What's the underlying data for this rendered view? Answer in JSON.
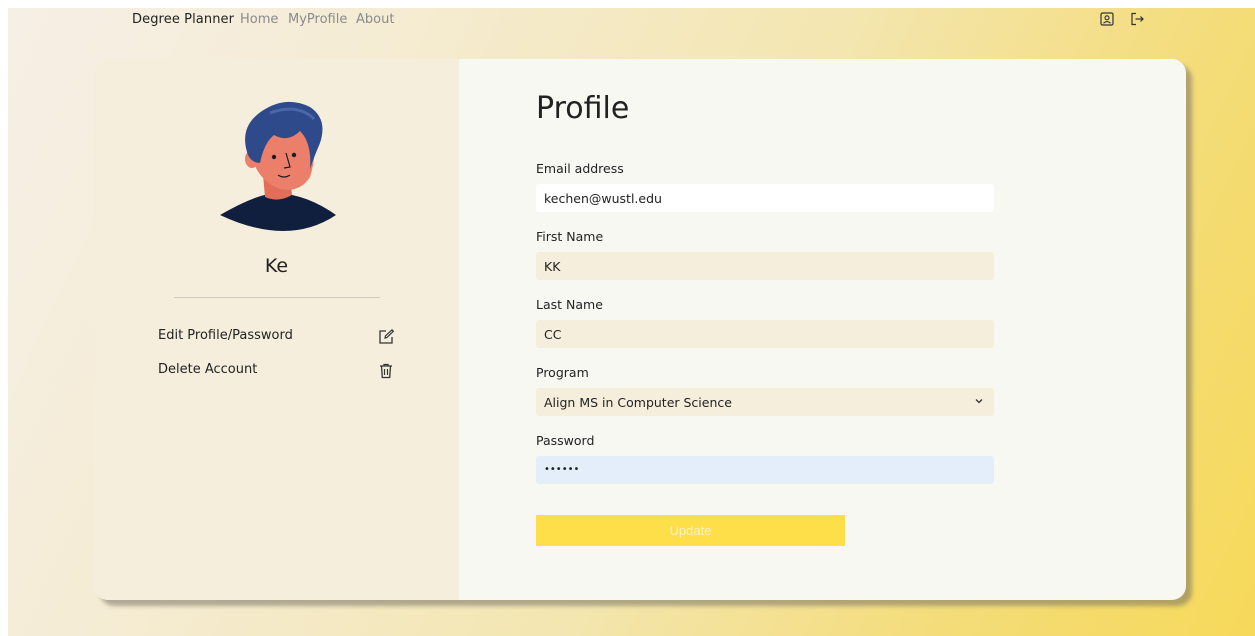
{
  "navbar": {
    "brand": "Degree Planner",
    "links": [
      "Home",
      "MyProfile",
      "About"
    ],
    "icons": [
      "profile-icon",
      "logout-icon"
    ]
  },
  "sidebar": {
    "user_name": "Ke",
    "menu": [
      {
        "label": "Edit Profile/Password",
        "icon": "edit-icon"
      },
      {
        "label": "Delete Account",
        "icon": "trash-icon"
      }
    ]
  },
  "profile": {
    "title": "Profile",
    "fields": {
      "email": {
        "label": "Email address",
        "value": "kechen@wustl.edu"
      },
      "first_name": {
        "label": "First Name",
        "value": "KK"
      },
      "last_name": {
        "label": "Last Name",
        "value": "CC"
      },
      "program": {
        "label": "Program",
        "value": "Align MS in Computer Science"
      },
      "password": {
        "label": "Password",
        "value": "••••••"
      }
    },
    "submit_label": "Update"
  },
  "colors": {
    "accent": "#fedf4a",
    "panel": "#f6eedd",
    "avatar_hair": "#2e4a8a",
    "avatar_skin": "#ec7f6a",
    "avatar_shirt": "#0f1f3d"
  }
}
